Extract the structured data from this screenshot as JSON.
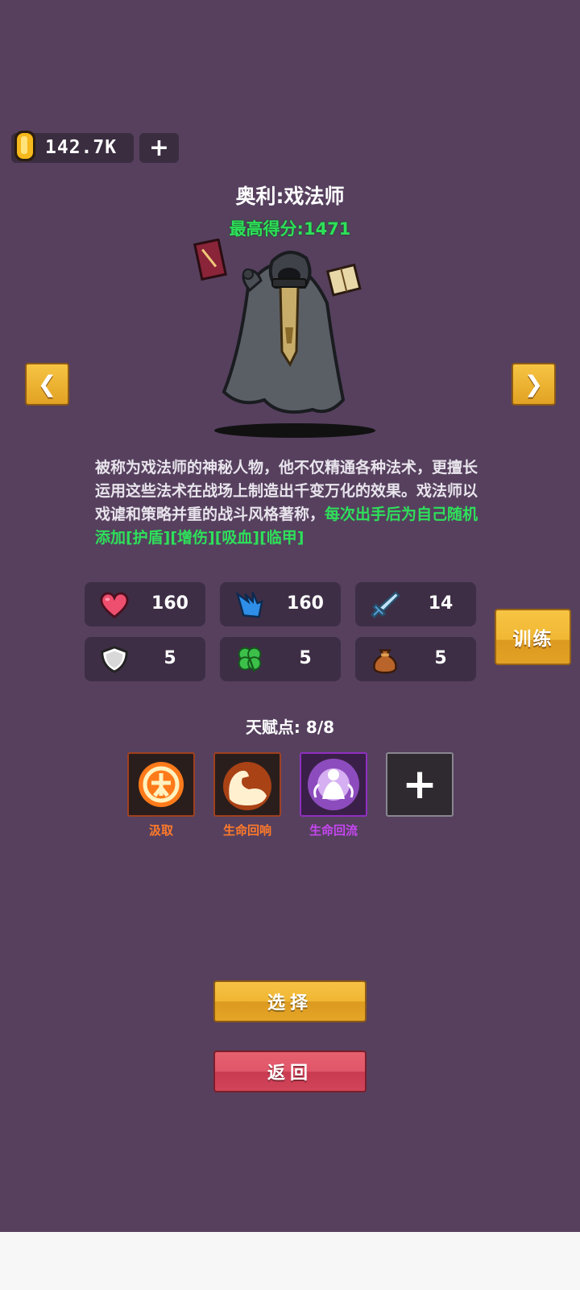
{
  "currency": {
    "amount": "142.7K",
    "add_label": "+"
  },
  "character": {
    "name": "奥利:戏法师",
    "high_score": "最高得分:1471",
    "prev_label": "❮",
    "next_label": "❯",
    "description_normal": "被称为戏法师的神秘人物，他不仅精通各种法术，更擅长运用这些法术在战场上制造出千变万化的效果。戏法师以戏谑和策略并重的战斗风格著称，",
    "description_highlight": "每次出手后为自己随机添加[护盾][增伤][吸血][临甲]"
  },
  "stats": [
    {
      "icon": "heart-icon",
      "value": "160"
    },
    {
      "icon": "claw-icon",
      "value": "160"
    },
    {
      "icon": "sword-icon",
      "value": "14"
    },
    {
      "icon": "shield-icon",
      "value": "5"
    },
    {
      "icon": "clover-icon",
      "value": "5"
    },
    {
      "icon": "money-bag-icon",
      "value": "5"
    }
  ],
  "train_label": "训练",
  "talents": {
    "points_label": "天赋点: 8/8",
    "items": [
      {
        "label": "汲取",
        "color": "#ff7a2a"
      },
      {
        "label": "生命回响",
        "color": "#ff7a2a"
      },
      {
        "label": "生命回流",
        "color": "#c646f0"
      }
    ],
    "add_label": "+"
  },
  "buttons": {
    "select": "选择",
    "back": "返回"
  },
  "colors": {
    "background": "#56405e",
    "accent_gold": "#f0b632",
    "accent_red": "#e0566a",
    "highlight_green": "#2ee05a"
  }
}
